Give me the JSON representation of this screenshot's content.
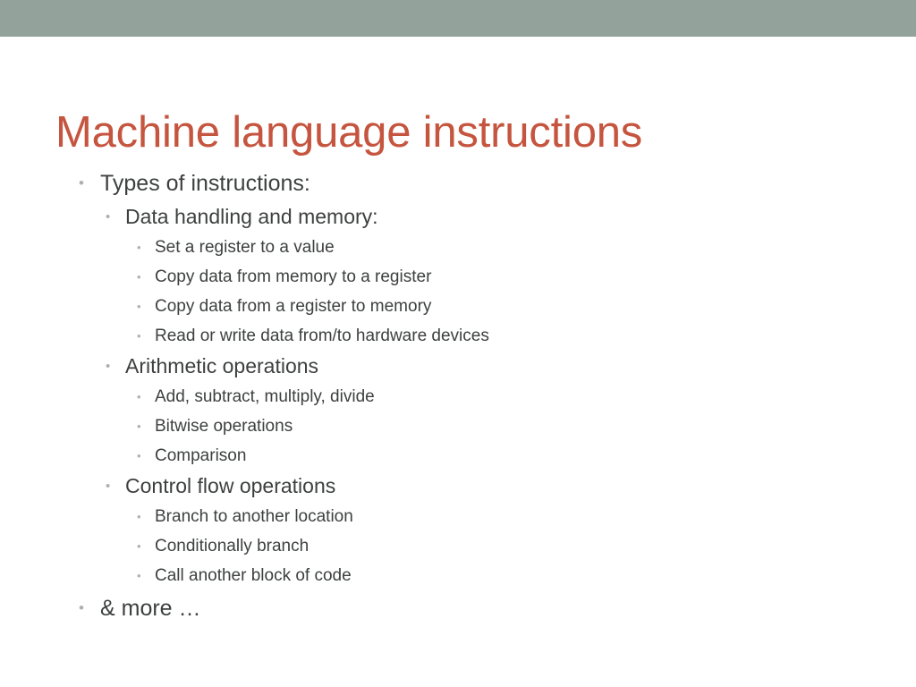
{
  "slide": {
    "title": "Machine language instructions",
    "title_color": "#c5553f",
    "body_text_color": "#3e4040",
    "bullet_glyph_color": "#adb0b0",
    "background_color": "#ffffff",
    "top_band_color": "#93a29b",
    "bullet_glyph": "•"
  },
  "outline": [
    {
      "level": 1,
      "text": "Types of instructions:"
    },
    {
      "level": 2,
      "text": "Data handling and memory:"
    },
    {
      "level": 3,
      "text": "Set a register to a value"
    },
    {
      "level": 3,
      "text": "Copy data from memory to a register"
    },
    {
      "level": 3,
      "text": "Copy data from a register to memory"
    },
    {
      "level": 3,
      "text": "Read or write data from/to hardware devices"
    },
    {
      "level": 2,
      "text": "Arithmetic operations"
    },
    {
      "level": 3,
      "text": "Add, subtract, multiply, divide"
    },
    {
      "level": 3,
      "text": "Bitwise operations"
    },
    {
      "level": 3,
      "text": "Comparison"
    },
    {
      "level": 2,
      "text": "Control flow operations"
    },
    {
      "level": 3,
      "text": "Branch to another location"
    },
    {
      "level": 3,
      "text": "Conditionally branch"
    },
    {
      "level": 3,
      "text": "Call another block of code"
    },
    {
      "level": 1,
      "text": "& more …"
    }
  ]
}
